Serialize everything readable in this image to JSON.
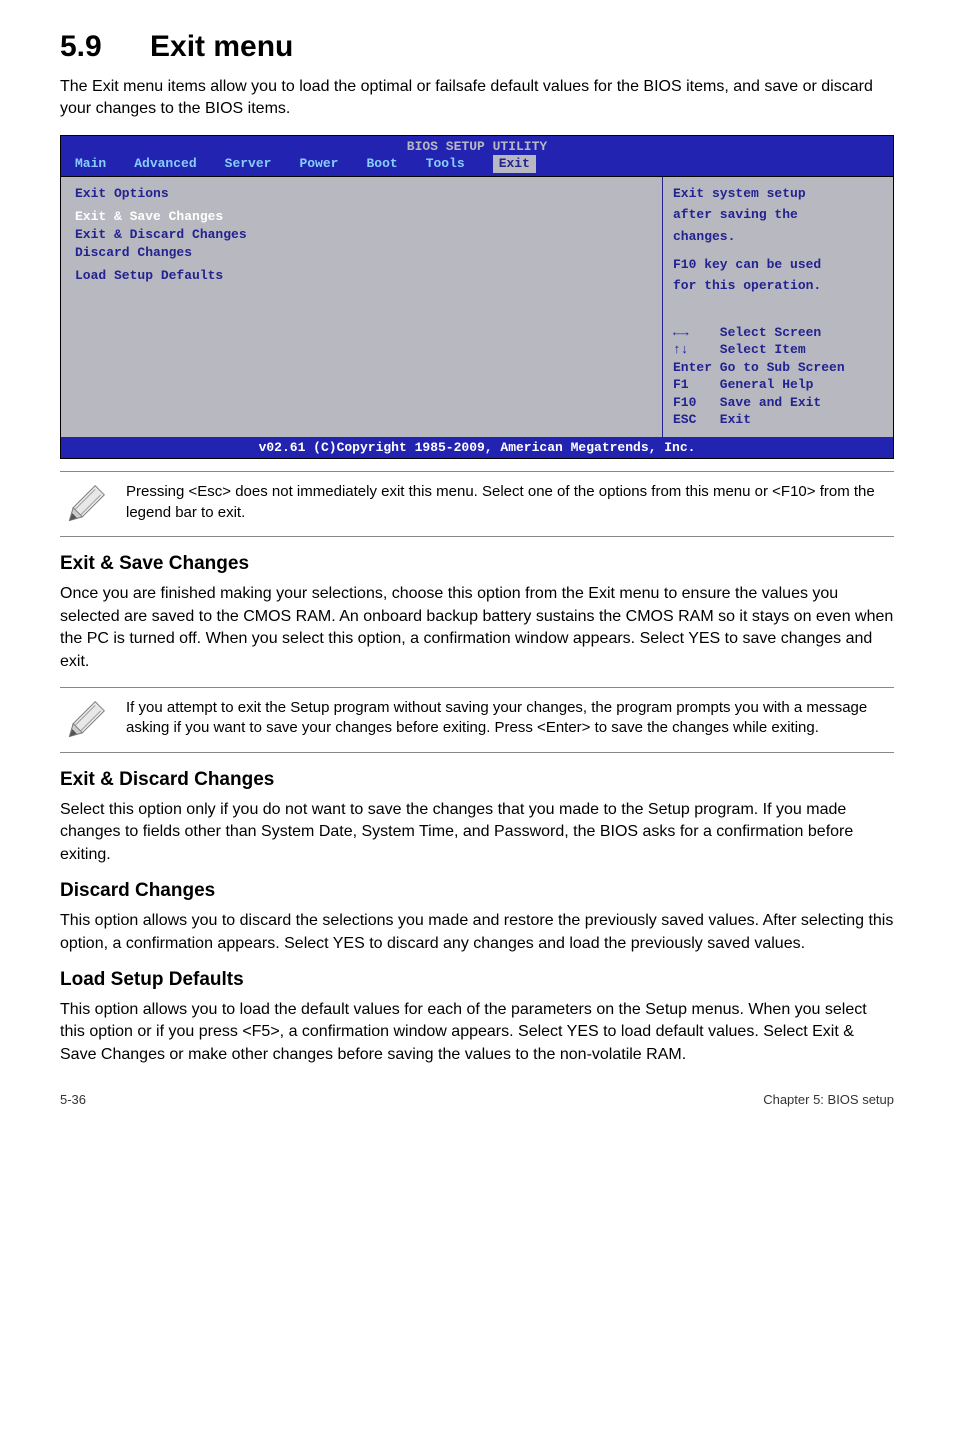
{
  "heading": {
    "number": "5.9",
    "title": "Exit menu"
  },
  "lead": "The Exit menu items allow you to load the optimal or failsafe default values for the BIOS items, and save or discard your changes to the BIOS items.",
  "bios": {
    "title": "BIOS SETUP UTILITY",
    "tabs": [
      "Main",
      "Advanced",
      "Server",
      "Power",
      "Boot",
      "Tools",
      "Exit"
    ],
    "left": {
      "heading": "Exit Options",
      "items": [
        "Exit & Save Changes",
        "Exit & Discard Changes",
        "Discard Changes",
        "Load Setup Defaults"
      ]
    },
    "help": {
      "l1": "Exit system setup",
      "l2": "after saving the",
      "l3": "changes.",
      "l4": "F10 key can be used",
      "l5": "for this operation."
    },
    "keys": {
      "k1": "←→    Select Screen",
      "k2": "↑↓    Select Item",
      "k3": "Enter Go to Sub Screen",
      "k4": "F1    General Help",
      "k5": "F10   Save and Exit",
      "k6": "ESC   Exit"
    },
    "footer": "v02.61 (C)Copyright 1985-2009, American Megatrends, Inc."
  },
  "note1": "Pressing <Esc> does not immediately exit this menu. Select one of the options from this menu or <F10> from the legend bar to exit.",
  "sections": {
    "s1_title": "Exit & Save Changes",
    "s1_body": "Once you are finished making your selections, choose this option from the Exit menu to ensure the values you selected are saved to the CMOS RAM. An onboard backup battery sustains the CMOS RAM so it stays on even when the PC is turned off. When you select this option, a confirmation window appears. Select YES to save changes and exit.",
    "note2": "If you attempt to exit the Setup program without saving your changes, the program prompts you with a message asking if you want to save your changes before exiting. Press <Enter> to save the changes while exiting.",
    "s2_title": "Exit & Discard Changes",
    "s2_body": "Select this option only if you do not want to save the changes that you made to the Setup program. If you made changes to fields other than System Date, System Time, and Password, the BIOS asks for a confirmation before exiting.",
    "s3_title": "Discard Changes",
    "s3_body": "This option allows you to discard the selections you made and restore the previously saved values. After selecting this option, a confirmation appears. Select YES to discard any changes and load the previously saved values.",
    "s4_title": "Load Setup Defaults",
    "s4_body": "This option allows you to load the default values for each of the parameters on the Setup menus. When you select this option or if you press <F5>, a confirmation window appears. Select YES to load default values. Select Exit & Save Changes or make other changes before saving the values to the non-volatile RAM."
  },
  "footer": {
    "left": "5-36",
    "right": "Chapter 5: BIOS setup"
  }
}
